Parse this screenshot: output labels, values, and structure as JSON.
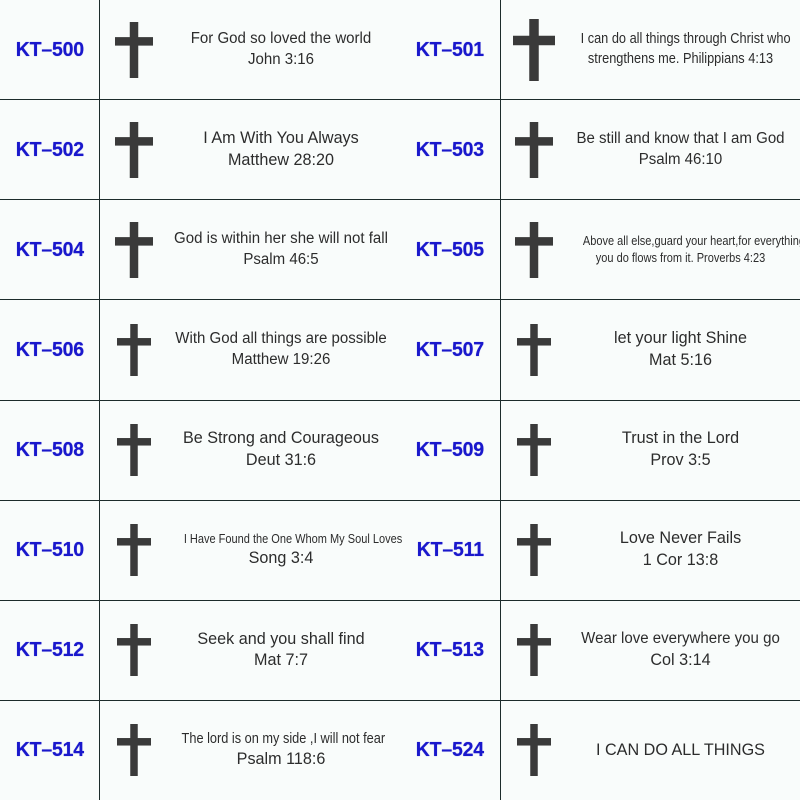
{
  "catalog": {
    "grid_columns": 2,
    "grid_rows": 8,
    "code_color": "#1a18cc",
    "cross_color": "#3a3a3a",
    "text_color": "#2c2c2c",
    "background": "#f9fcfb",
    "border_color": "#1d2b2b",
    "cross_icon_name": "christian-cross-icon",
    "items": [
      {
        "code": "KT–500",
        "line1": "For God so loved the world",
        "line2": "John 3:16",
        "style1": "t-normal",
        "style2": "t-normal",
        "cross_size": "medium"
      },
      {
        "code": "KT–501",
        "line1": "I can do all things through Christ who",
        "line2": "strengthens me.  Philippians 4:13",
        "style1": "t-cond",
        "style2": "t-cond",
        "cross_size": "large"
      },
      {
        "code": "KT–502",
        "line1": "I Am With You Always",
        "line2": "Matthew 28:20",
        "style1": "t-big",
        "style2": "t-big",
        "cross_size": "medium"
      },
      {
        "code": "KT–503",
        "line1": "Be still and know that I am God",
        "line2": "Psalm 46:10",
        "style1": "t-normal",
        "style2": "t-normal",
        "cross_size": "medium"
      },
      {
        "code": "KT–504",
        "line1": "God is within her she will not fall",
        "line2": "Psalm 46:5",
        "style1": "t-normal",
        "style2": "t-normal",
        "cross_size": "medium"
      },
      {
        "code": "KT–505",
        "line1": "Above all else,guard your heart,for everything",
        "line2": "you do flows from it.  Proverbs 4:23",
        "style1": "t-tiny",
        "style2": "t-tiny",
        "cross_size": "medium"
      },
      {
        "code": "KT–506",
        "line1": "With God all things are possible",
        "line2": "Matthew 19:26",
        "style1": "t-normal",
        "style2": "t-normal",
        "cross_size": "small"
      },
      {
        "code": "KT–507",
        "line1": "let your light Shine",
        "line2": "Mat 5:16",
        "style1": "t-big",
        "style2": "t-big",
        "cross_size": "small"
      },
      {
        "code": "KT–508",
        "line1": "Be Strong and Courageous",
        "line2": "Deut 31:6",
        "style1": "t-big",
        "style2": "t-big",
        "cross_size": "small"
      },
      {
        "code": "KT–509",
        "line1": "Trust in the Lord",
        "line2": "Prov 3:5",
        "style1": "t-big",
        "style2": "t-big",
        "cross_size": "small"
      },
      {
        "code": "KT–510",
        "line1": "I Have Found the One Whom My Soul Loves",
        "line2": "Song 3:4",
        "style1": "t-tiny",
        "style2": "t-big",
        "cross_size": "small"
      },
      {
        "code": "KT–511",
        "line1": "Love Never Fails",
        "line2": "1 Cor 13:8",
        "style1": "t-big",
        "style2": "t-big",
        "cross_size": "small"
      },
      {
        "code": "KT–512",
        "line1": "Seek and you shall find",
        "line2": "Mat 7:7",
        "style1": "t-big",
        "style2": "t-big",
        "cross_size": "small"
      },
      {
        "code": "KT–513",
        "line1": "Wear love everywhere you go",
        "line2": "Col 3:14",
        "style1": "t-normal",
        "style2": "t-big",
        "cross_size": "small"
      },
      {
        "code": "KT–514",
        "line1": "The lord is on my side ,I will not fear",
        "line2": "Psalm 118:6",
        "style1": "t-cond",
        "style2": "t-big",
        "cross_size": "small"
      },
      {
        "code": "KT–524",
        "line1": "I CAN DO ALL THINGS",
        "line2": "",
        "style1": "t-big",
        "style2": "t-big",
        "cross_size": "small"
      }
    ]
  }
}
